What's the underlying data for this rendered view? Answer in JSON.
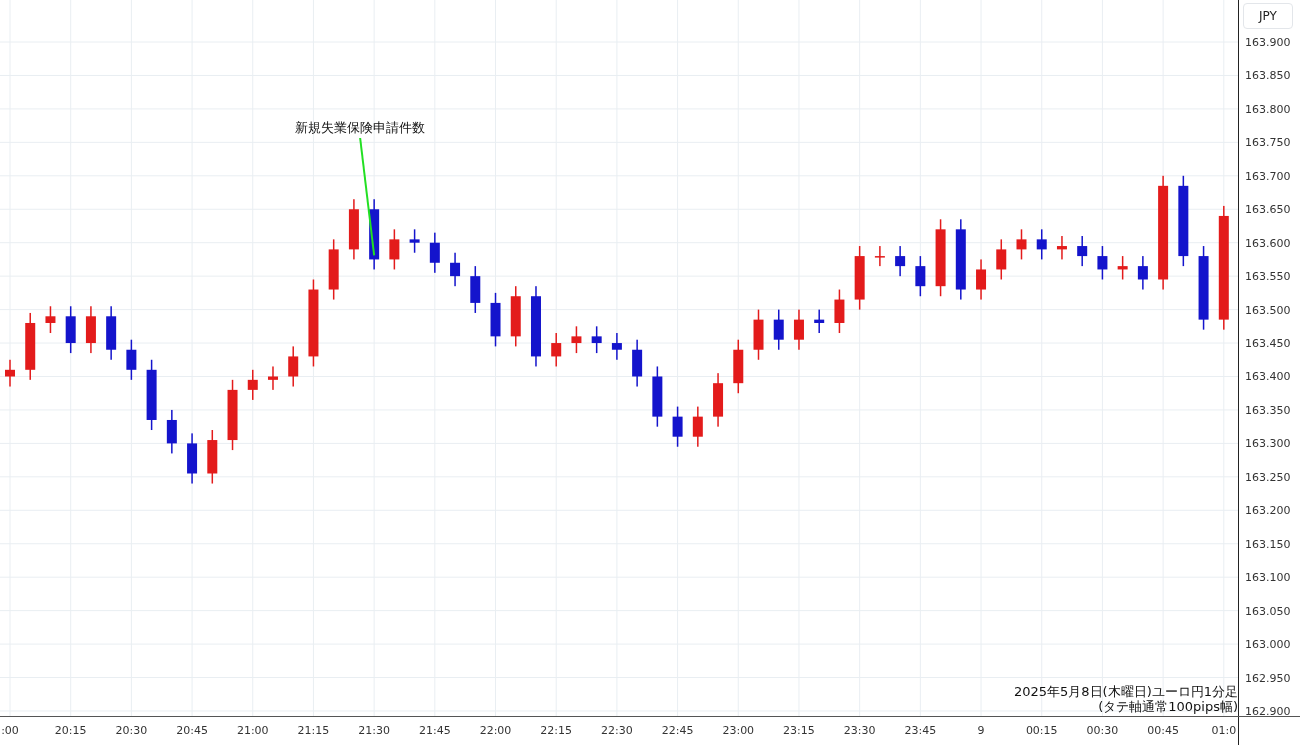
{
  "chart": {
    "currency_button": "JPY",
    "caption_lines": [
      "2025年5月8日(木曜日)ユーロ円1分足",
      "(タテ軸通常100pips幅)"
    ],
    "chart_data": {
      "type": "candlestick",
      "categories": [
        ":00",
        null,
        null,
        "20:15",
        null,
        null,
        "20:30",
        null,
        null,
        "20:45",
        null,
        null,
        "21:00",
        null,
        null,
        "21:15",
        null,
        null,
        "21:30",
        null,
        null,
        "21:45",
        null,
        null,
        "22:00",
        null,
        null,
        "22:15",
        null,
        null,
        "22:30",
        null,
        null,
        "22:45",
        null,
        null,
        "23:00",
        null,
        null,
        "23:15",
        null,
        null,
        "23:30",
        null,
        null,
        "23:45",
        null,
        null,
        "9",
        null,
        null,
        "00:15",
        null,
        null,
        "00:30",
        null,
        null,
        "00:45",
        null,
        null,
        "01:0"
      ],
      "ohlc": [
        [
          163.4,
          163.425,
          163.385,
          163.41
        ],
        [
          163.41,
          163.495,
          163.395,
          163.48
        ],
        [
          163.48,
          163.505,
          163.465,
          163.49
        ],
        [
          163.49,
          163.505,
          163.435,
          163.45
        ],
        [
          163.45,
          163.505,
          163.435,
          163.49
        ],
        [
          163.49,
          163.505,
          163.425,
          163.44
        ],
        [
          163.44,
          163.455,
          163.395,
          163.41
        ],
        [
          163.41,
          163.425,
          163.32,
          163.335
        ],
        [
          163.335,
          163.35,
          163.285,
          163.3
        ],
        [
          163.3,
          163.315,
          163.24,
          163.255
        ],
        [
          163.255,
          163.32,
          163.24,
          163.305
        ],
        [
          163.305,
          163.395,
          163.29,
          163.38
        ],
        [
          163.38,
          163.41,
          163.365,
          163.395
        ],
        [
          163.395,
          163.415,
          163.38,
          163.4
        ],
        [
          163.4,
          163.445,
          163.385,
          163.43
        ],
        [
          163.43,
          163.545,
          163.415,
          163.53
        ],
        [
          163.53,
          163.605,
          163.515,
          163.59
        ],
        [
          163.59,
          163.665,
          163.575,
          163.65
        ],
        [
          163.65,
          163.665,
          163.56,
          163.575
        ],
        [
          163.575,
          163.62,
          163.56,
          163.605
        ],
        [
          163.605,
          163.62,
          163.585,
          163.6
        ],
        [
          163.6,
          163.615,
          163.555,
          163.57
        ],
        [
          163.57,
          163.585,
          163.535,
          163.55
        ],
        [
          163.55,
          163.565,
          163.495,
          163.51
        ],
        [
          163.51,
          163.525,
          163.445,
          163.46
        ],
        [
          163.46,
          163.535,
          163.445,
          163.52
        ],
        [
          163.52,
          163.535,
          163.415,
          163.43
        ],
        [
          163.43,
          163.465,
          163.415,
          163.45
        ],
        [
          163.45,
          163.475,
          163.435,
          163.46
        ],
        [
          163.46,
          163.475,
          163.435,
          163.45
        ],
        [
          163.45,
          163.465,
          163.425,
          163.44
        ],
        [
          163.44,
          163.455,
          163.385,
          163.4
        ],
        [
          163.4,
          163.415,
          163.325,
          163.34
        ],
        [
          163.34,
          163.355,
          163.295,
          163.31
        ],
        [
          163.31,
          163.355,
          163.295,
          163.34
        ],
        [
          163.34,
          163.405,
          163.325,
          163.39
        ],
        [
          163.39,
          163.455,
          163.375,
          163.44
        ],
        [
          163.44,
          163.5,
          163.425,
          163.485
        ],
        [
          163.485,
          163.5,
          163.44,
          163.455
        ],
        [
          163.455,
          163.5,
          163.44,
          163.485
        ],
        [
          163.485,
          163.5,
          163.465,
          163.48
        ],
        [
          163.48,
          163.53,
          163.465,
          163.515
        ],
        [
          163.515,
          163.595,
          163.5,
          163.58
        ],
        [
          163.58,
          163.595,
          163.565,
          163.58
        ],
        [
          163.58,
          163.595,
          163.55,
          163.565
        ],
        [
          163.565,
          163.58,
          163.52,
          163.535
        ],
        [
          163.535,
          163.635,
          163.52,
          163.62
        ],
        [
          163.62,
          163.635,
          163.515,
          163.53
        ],
        [
          163.53,
          163.575,
          163.515,
          163.56
        ],
        [
          163.56,
          163.605,
          163.545,
          163.59
        ],
        [
          163.59,
          163.62,
          163.575,
          163.605
        ],
        [
          163.605,
          163.62,
          163.575,
          163.59
        ],
        [
          163.59,
          163.61,
          163.575,
          163.595
        ],
        [
          163.595,
          163.61,
          163.565,
          163.58
        ],
        [
          163.58,
          163.595,
          163.545,
          163.56
        ],
        [
          163.56,
          163.58,
          163.545,
          163.565
        ],
        [
          163.565,
          163.58,
          163.53,
          163.545
        ],
        [
          163.545,
          163.7,
          163.53,
          163.685
        ],
        [
          163.685,
          163.7,
          163.565,
          163.58
        ],
        [
          163.58,
          163.595,
          163.47,
          163.485
        ],
        [
          163.485,
          163.655,
          163.47,
          163.64
        ]
      ],
      "ylim": [
        162.8925,
        163.9628
      ],
      "grid": true,
      "yticks": [
        {
          "value": 163.9,
          "label": "163.900"
        },
        {
          "value": 163.85,
          "label": "163.850"
        },
        {
          "value": 163.8,
          "label": "163.800"
        },
        {
          "value": 163.75,
          "label": "163.750"
        },
        {
          "value": 163.7,
          "label": "163.700"
        },
        {
          "value": 163.65,
          "label": "163.650"
        },
        {
          "value": 163.6,
          "label": "163.600"
        },
        {
          "value": 163.55,
          "label": "163.550"
        },
        {
          "value": 163.5,
          "label": "163.500"
        },
        {
          "value": 163.45,
          "label": "163.450"
        },
        {
          "value": 163.4,
          "label": "163.400"
        },
        {
          "value": 163.35,
          "label": "163.350"
        },
        {
          "value": 163.3,
          "label": "163.300"
        },
        {
          "value": 163.25,
          "label": "163.250"
        },
        {
          "value": 163.2,
          "label": "163.200"
        },
        {
          "value": 163.15,
          "label": "163.150"
        },
        {
          "value": 163.1,
          "label": "163.100"
        },
        {
          "value": 163.05,
          "label": "163.050"
        },
        {
          "value": 163.0,
          "label": "163.000"
        },
        {
          "value": 162.95,
          "label": "162.950"
        },
        {
          "value": 162.9,
          "label": "162.900"
        }
      ],
      "annotations": [
        {
          "text": "新規失業保険申請件数",
          "x": "21:30",
          "y": 163.575
        }
      ]
    }
  }
}
